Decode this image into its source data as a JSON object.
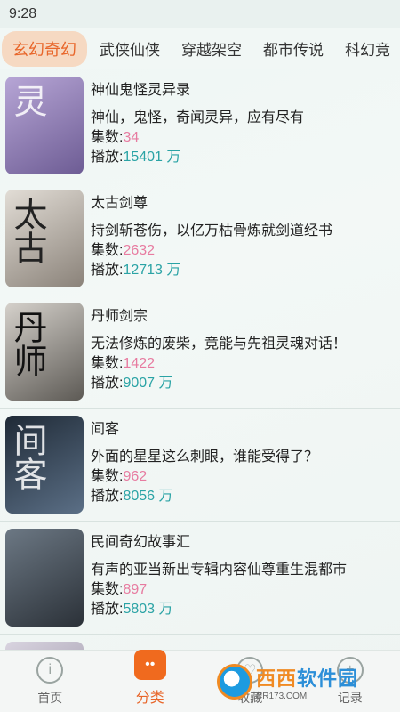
{
  "status": {
    "time": "9:28"
  },
  "tabs": [
    {
      "label": "玄幻奇幻",
      "active": true
    },
    {
      "label": "武侠仙侠"
    },
    {
      "label": "穿越架空"
    },
    {
      "label": "都市传说"
    },
    {
      "label": "科幻竞"
    }
  ],
  "meta_labels": {
    "episodes": "集数:",
    "plays": "播放:",
    "unit": "万"
  },
  "items": [
    {
      "title": "神仙鬼怪灵异录",
      "desc": "神仙，鬼怪，奇闻灵异，应有尽有",
      "episodes": "34",
      "plays": "15401",
      "cover_glyph": "灵",
      "cover_color": "#8e7bb3"
    },
    {
      "title": "太古剑尊",
      "desc": "持剑斩苍伤，以亿万枯骨炼就剑道经书",
      "episodes": "2632",
      "plays": "12713",
      "cover_glyph": "太古",
      "cover_color": "#c9c2b8"
    },
    {
      "title": "丹师剑宗",
      "desc": "无法修炼的废柴，竟能与先祖灵魂对话！",
      "episodes": "1422",
      "plays": "9007",
      "cover_glyph": "丹师",
      "cover_color": "#9a9690"
    },
    {
      "title": "间客",
      "desc": "外面的星星这么刺眼，谁能受得了？",
      "episodes": "962",
      "plays": "8056",
      "cover_glyph": "间客",
      "cover_color": "#3b4a5a"
    },
    {
      "title": "民间奇幻故事汇",
      "desc": "有声的亚当新出专辑内容仙尊重生混都市",
      "episodes": "897",
      "plays": "5803",
      "cover_glyph": "",
      "cover_color": "#4a5560"
    },
    {
      "title": "",
      "desc": "",
      "episodes": "",
      "plays": "",
      "cover_glyph": "",
      "cover_color": "#b9b4c2"
    }
  ],
  "nav": {
    "home": "首页",
    "category": "分类",
    "collect": "收藏",
    "record": "记录"
  },
  "watermark": {
    "main_a": "西西",
    "main_b": "软件园",
    "sub": "CR173.COM"
  }
}
